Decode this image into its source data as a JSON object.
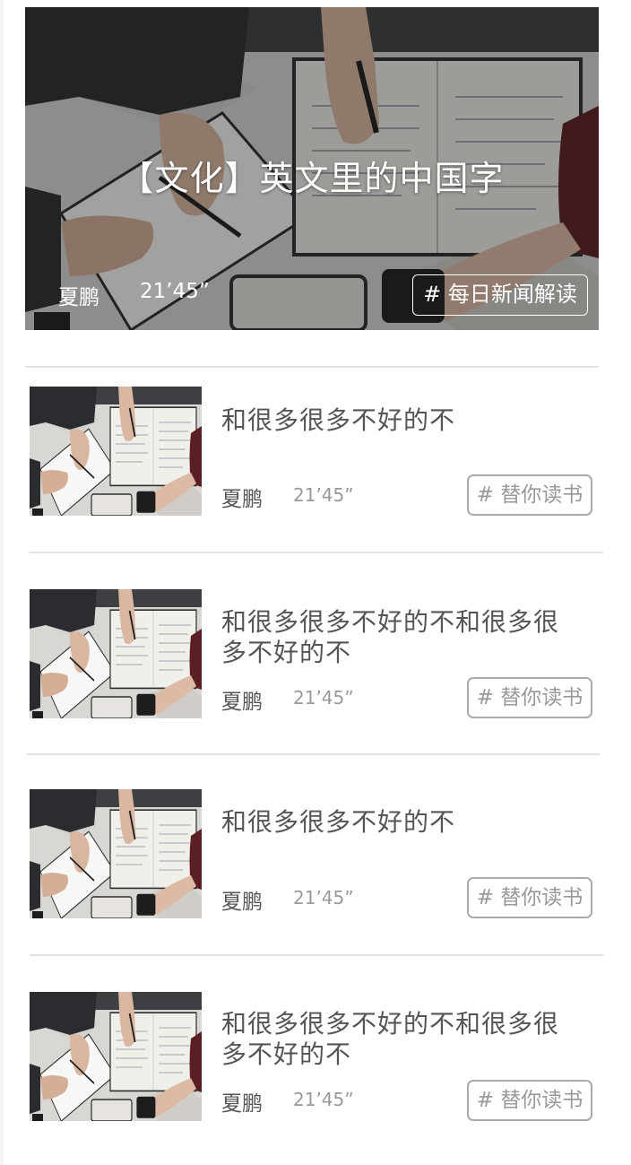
{
  "featured": {
    "title": "【文化】英文里的中国字",
    "author": "夏鹏",
    "duration": "21’45”",
    "tag": "# 每日新闻解读",
    "image_icon": "desk-notebook-photo"
  },
  "list": {
    "items": [
      {
        "title": "和很多很多不好的不",
        "author": "夏鹏",
        "duration": "21’45”",
        "tag": "# 替你读书"
      },
      {
        "title": "和很多很多不好的不和很多很多不好的不",
        "author": "夏鹏",
        "duration": "21’45”",
        "tag": "# 替你读书"
      },
      {
        "title": "和很多很多不好的不",
        "author": "夏鹏",
        "duration": "21’45”",
        "tag": "# 替你读书"
      },
      {
        "title": "和很多很多不好的不和很多很多不好的不",
        "author": "夏鹏",
        "duration": "21’45”",
        "tag": "# 替你读书"
      }
    ]
  }
}
